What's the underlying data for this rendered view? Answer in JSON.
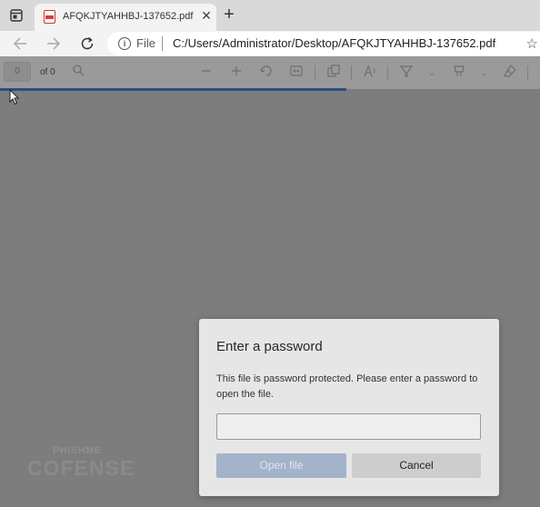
{
  "tab": {
    "title": "AFQKJTYAHHBJ-137652.pdf",
    "close": "✕"
  },
  "new_tab": "+",
  "address_bar": {
    "scheme_label": "File",
    "url": "C:/Users/Administrator/Desktop/AFQKJTYAHHBJ-137652.pdf"
  },
  "pdf_toolbar": {
    "page_number": "0",
    "page_count": "of 0"
  },
  "watermark": {
    "top": "PHISHME",
    "main": "COFENSE"
  },
  "dialog": {
    "title": "Enter a password",
    "message": "This file is password protected. Please enter a password to open the file.",
    "password_value": "",
    "open_label": "Open file",
    "cancel_label": "Cancel"
  },
  "icons": [
    "window-menu-icon",
    "pdf-file-icon",
    "back-icon",
    "forward-icon",
    "reload-icon",
    "info-icon",
    "favorites-icon",
    "search-icon",
    "zoom-out-icon",
    "zoom-in-icon",
    "rotate-icon",
    "fit-page-icon",
    "page-view-icon",
    "read-aloud-icon",
    "highlight-icon",
    "draw-icon",
    "erase-icon",
    "cursor-icon"
  ],
  "colors": {
    "progress_bar": "#2a4f86",
    "open_button": "#a3b3c9",
    "cancel_button": "#cdcdcd"
  }
}
